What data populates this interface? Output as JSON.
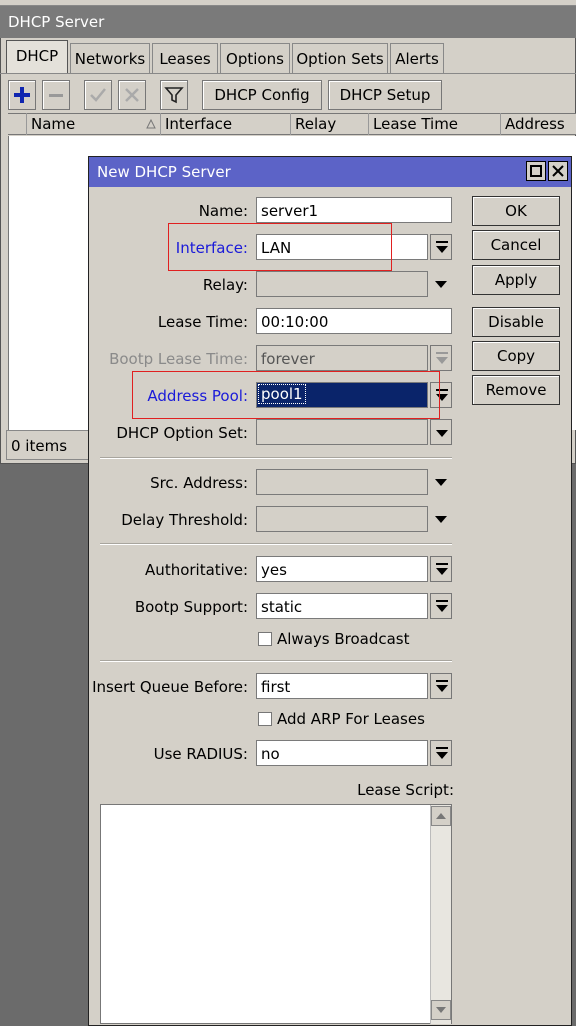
{
  "main_window": {
    "title": "DHCP Server",
    "tabs": [
      "DHCP",
      "Networks",
      "Leases",
      "Options",
      "Option Sets",
      "Alerts"
    ],
    "toolbar": {
      "config_label": "DHCP Config",
      "setup_label": "DHCP Setup"
    },
    "columns": [
      "Name",
      "Interface",
      "Relay",
      "Lease Time",
      "Address P"
    ],
    "status": "0 items"
  },
  "dialog": {
    "title": "New DHCP Server",
    "fields": {
      "name": {
        "label": "Name:",
        "value": "server1"
      },
      "interface": {
        "label": "Interface:",
        "value": "LAN"
      },
      "relay": {
        "label": "Relay:",
        "value": ""
      },
      "lease_time": {
        "label": "Lease Time:",
        "value": "00:10:00"
      },
      "bootp_lease_time": {
        "label": "Bootp Lease Time:",
        "value": "forever"
      },
      "address_pool": {
        "label": "Address Pool:",
        "value": "pool1"
      },
      "dhcp_option_set": {
        "label": "DHCP Option Set:",
        "value": ""
      },
      "src_address": {
        "label": "Src. Address:",
        "value": ""
      },
      "delay_threshold": {
        "label": "Delay Threshold:",
        "value": ""
      },
      "authoritative": {
        "label": "Authoritative:",
        "value": "yes"
      },
      "bootp_support": {
        "label": "Bootp Support:",
        "value": "static"
      },
      "always_broadcast": {
        "label": "Always Broadcast"
      },
      "insert_queue_before": {
        "label": "Insert Queue Before:",
        "value": "first"
      },
      "add_arp": {
        "label": "Add ARP For Leases"
      },
      "use_radius": {
        "label": "Use RADIUS:",
        "value": "no"
      },
      "lease_script": {
        "label": "Lease Script:"
      }
    },
    "buttons": {
      "ok": "OK",
      "cancel": "Cancel",
      "apply": "Apply",
      "disable": "Disable",
      "copy": "Copy",
      "remove": "Remove"
    }
  },
  "colors": {
    "dialog_title_bg": "#5c63c7",
    "highlight": "#e02020",
    "link_label": "#1a1ad9",
    "selection": "#0a246a"
  }
}
